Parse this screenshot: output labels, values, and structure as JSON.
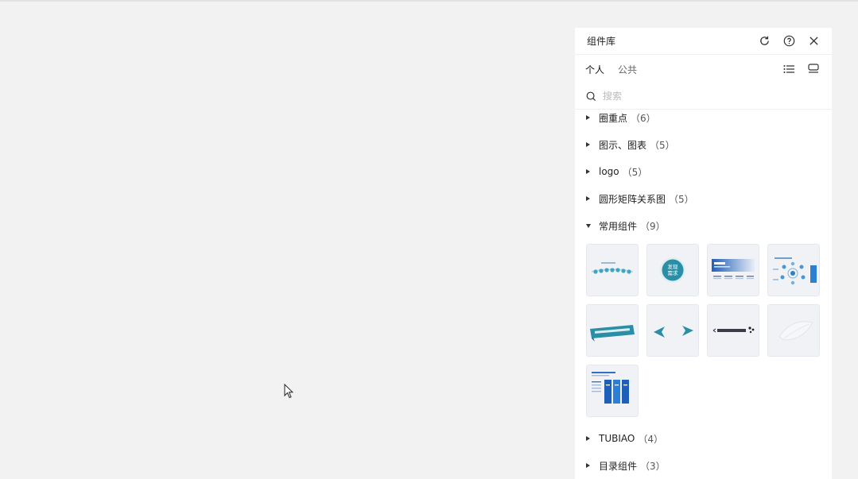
{
  "panel": {
    "title": "组件库",
    "tabs": [
      {
        "label": "个人",
        "active": true
      },
      {
        "label": "公共",
        "active": false
      }
    ],
    "search": {
      "placeholder": "搜索"
    }
  },
  "categories": [
    {
      "label": "圈重点",
      "count": "（6）",
      "expanded": false
    },
    {
      "label": "图示、图表",
      "count": "（5）",
      "expanded": false
    },
    {
      "label": "logo",
      "count": "（5）",
      "expanded": false
    },
    {
      "label": "圆形矩阵关系图",
      "count": "（5）",
      "expanded": false
    },
    {
      "label": "常用组件",
      "count": "（9）",
      "expanded": true
    },
    {
      "label": "TUBIAO",
      "count": "（4）",
      "expanded": false
    },
    {
      "label": "目录组件",
      "count": "（3）",
      "expanded": false
    }
  ],
  "components": [
    {
      "icon": "dot-timeline-thumbnail"
    },
    {
      "icon": "circle-badge-thumbnail",
      "text": [
        "发现",
        "需求"
      ]
    },
    {
      "icon": "blue-slide-thumbnail"
    },
    {
      "icon": "mind-map-thumbnail"
    },
    {
      "icon": "ribbon-banner-thumbnail"
    },
    {
      "icon": "arrows-thumbnail"
    },
    {
      "icon": "title-text-thumbnail"
    },
    {
      "icon": "leaf-shape-thumbnail"
    },
    {
      "icon": "infographic-thumbnail"
    }
  ],
  "colors": {
    "accent": "#2a8fa6",
    "blue": "#1f5fb8",
    "background": "#f2f2f2",
    "panel": "#ffffff"
  }
}
